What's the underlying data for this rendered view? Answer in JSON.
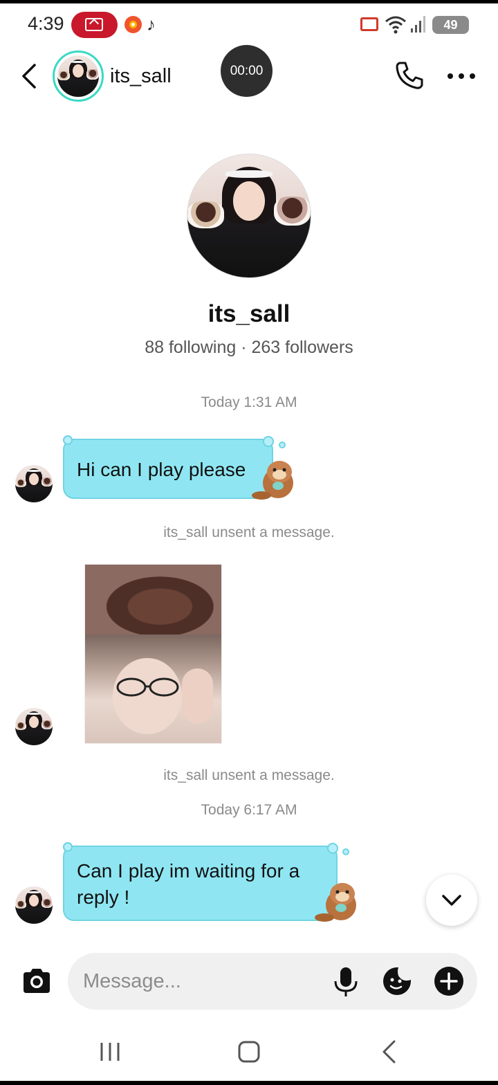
{
  "status_bar": {
    "time": "4:39",
    "battery": "49"
  },
  "header": {
    "username": "its_sall",
    "call_timer": "00:00"
  },
  "profile": {
    "name": "its_sall",
    "stats": "88 following · 263 followers"
  },
  "thread": {
    "timestamp_1": "Today 1:31 AM",
    "message_1": "Hi can I play please",
    "system_1": "its_sall unsent a message.",
    "system_2": "its_sall unsent a message.",
    "timestamp_2": "Today 6:17 AM",
    "message_2_line1": "Can I play im waiting for a",
    "message_2_line2": "reply !"
  },
  "composer": {
    "placeholder": "Message..."
  },
  "colors": {
    "bubble": "#8fe6f2",
    "bubble_border": "#6fd3e2",
    "avatar_ring": "#3ad9c5",
    "record_pill": "#c9182b"
  },
  "icons": {
    "back": "chevron-left-icon",
    "call": "phone-icon",
    "more": "more-horizontal-icon",
    "camera": "camera-icon",
    "mic": "microphone-icon",
    "sticker": "sticker-icon",
    "plus": "plus-circle-icon",
    "scroll": "chevron-down-icon"
  }
}
